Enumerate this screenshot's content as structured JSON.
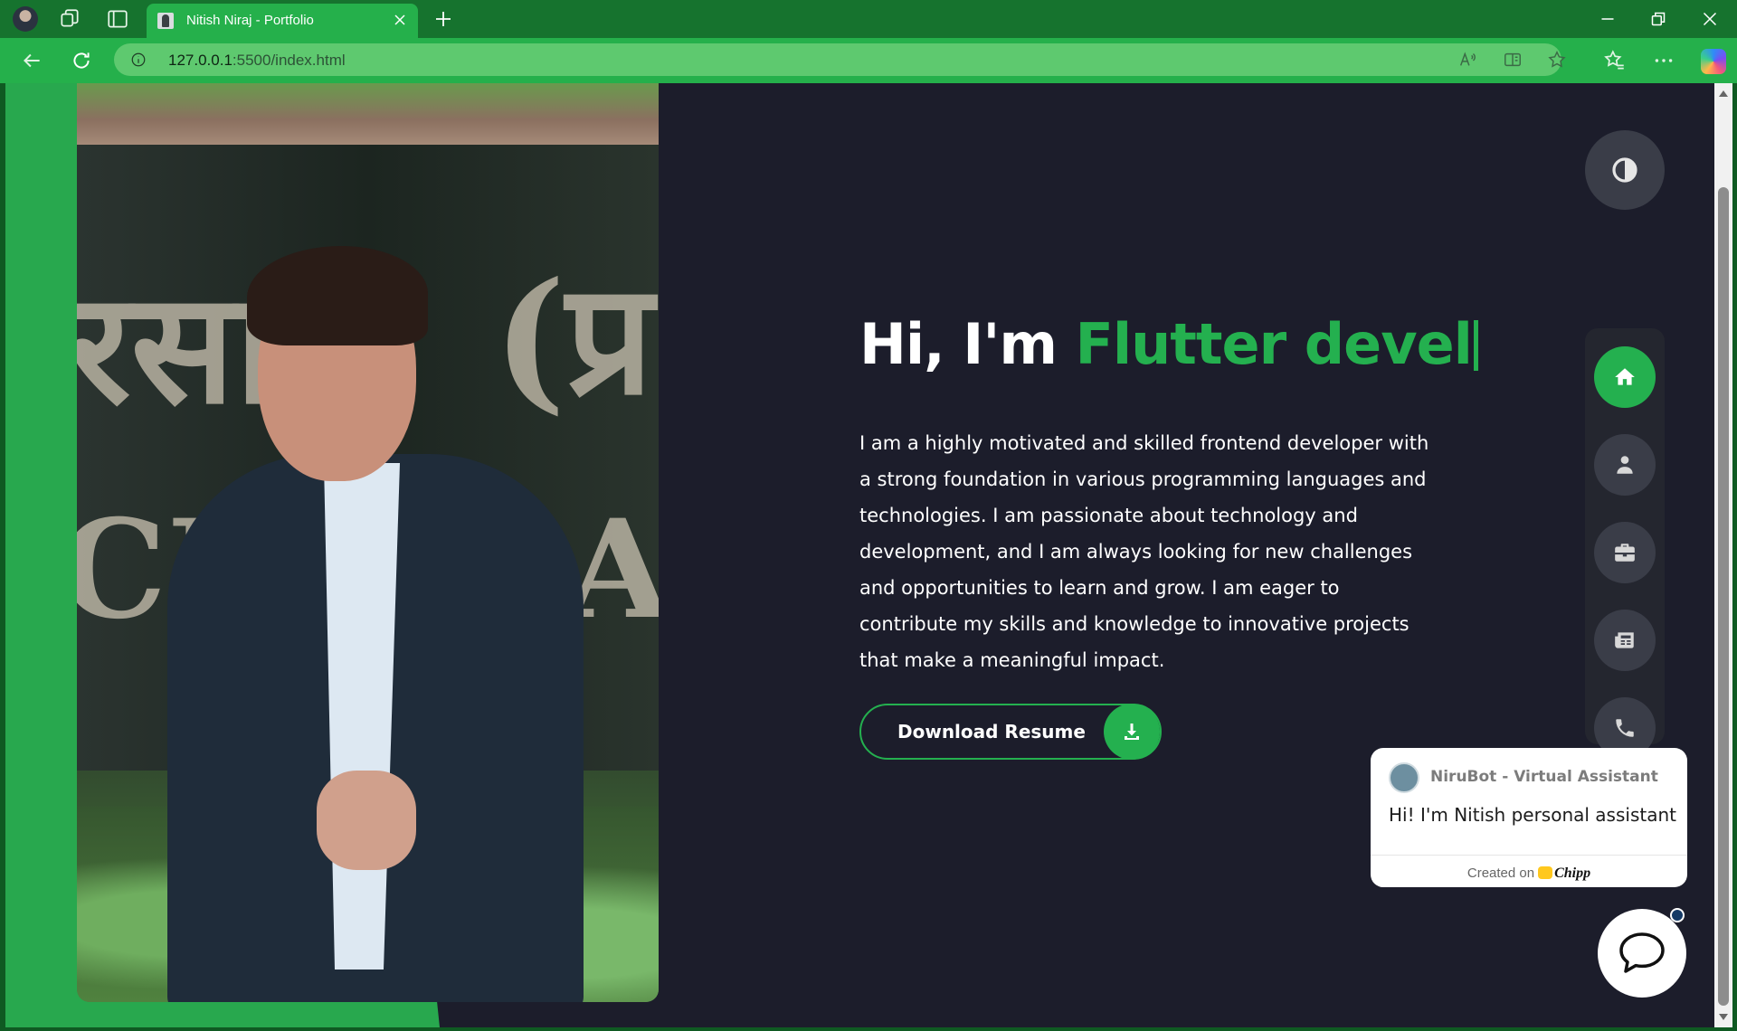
{
  "browser": {
    "tab_title": "Nitish Niraj - Portfolio",
    "url_host": "127.0.0.1",
    "url_path": ":5500/index.html"
  },
  "hero": {
    "greeting": "Hi, I'm ",
    "typed_text": "Flutter devel",
    "description": "I am a highly motivated and skilled frontend developer with a strong foundation in various programming languages and technologies. I am passionate about technology and development, and I am always looking for new challenges and opportunities to learn and grow. I am eager to contribute my skills and knowledge to innovative projects that make a meaningful impact.",
    "download_label": "Download Resume"
  },
  "nav": {
    "items": [
      {
        "icon": "home-icon",
        "active": true
      },
      {
        "icon": "user-icon",
        "active": false
      },
      {
        "icon": "briefcase-icon",
        "active": false
      },
      {
        "icon": "newspaper-icon",
        "active": false
      },
      {
        "icon": "phone-icon",
        "active": false
      }
    ]
  },
  "chat": {
    "bot_name": "NiruBot - Virtual Assistant",
    "greeting": "Hi! I'm Nitish personal assistant",
    "footer_prefix": "Created on",
    "footer_brand": "Chipp"
  },
  "colors": {
    "accent": "#24b04f",
    "page_bg": "#1c1d2b",
    "browser_bar": "#25b04b"
  }
}
